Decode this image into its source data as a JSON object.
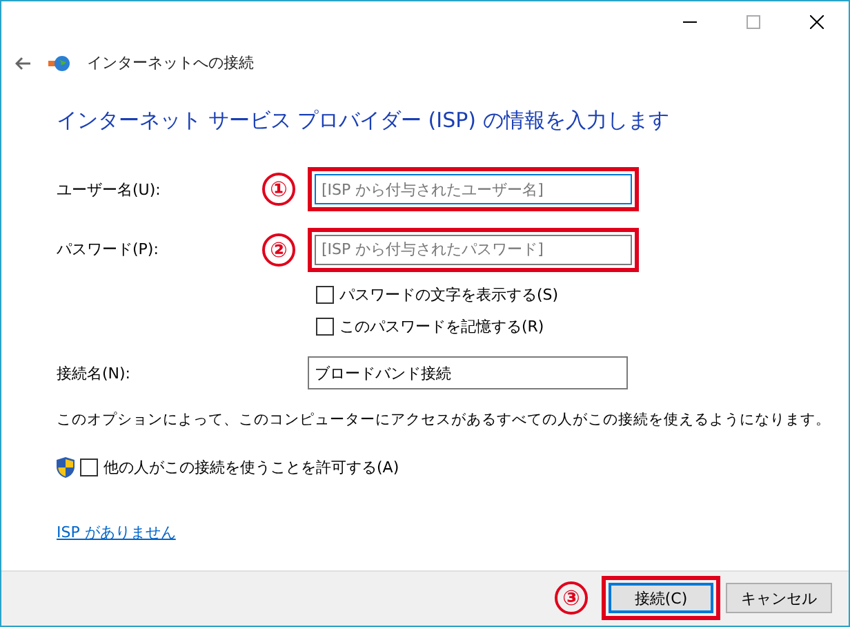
{
  "nav": {
    "title": "インターネットへの接続"
  },
  "heading": "インターネット サービス プロバイダー (ISP) の情報を入力します",
  "fields": [
    {
      "label": "ユーザー名(U):",
      "callout": "①",
      "placeholder": "[ISP から付与されたユーザー名]",
      "focused": true
    },
    {
      "label": "パスワード(P):",
      "callout": "②",
      "placeholder": "[ISP から付与されたパスワード]",
      "focused": false
    }
  ],
  "options": [
    {
      "label": "パスワードの文字を表示する(S)",
      "checked": false
    },
    {
      "label": "このパスワードを記憶する(R)",
      "checked": false
    }
  ],
  "connection_name": {
    "label": "接続名(N):",
    "value": "ブロードバンド接続"
  },
  "description": "このオプションによって、このコンピューターにアクセスがあるすべての人がこの接続を使えるようになります。",
  "allow_others": {
    "label": "他の人がこの接続を使うことを許可する(A)",
    "checked": false
  },
  "link": "ISP がありません",
  "footer": {
    "callout": "③",
    "buttons": [
      {
        "label": "接続(C)",
        "default": true,
        "highlighted": true
      },
      {
        "label": "キャンセル",
        "default": false,
        "highlighted": false
      }
    ]
  }
}
